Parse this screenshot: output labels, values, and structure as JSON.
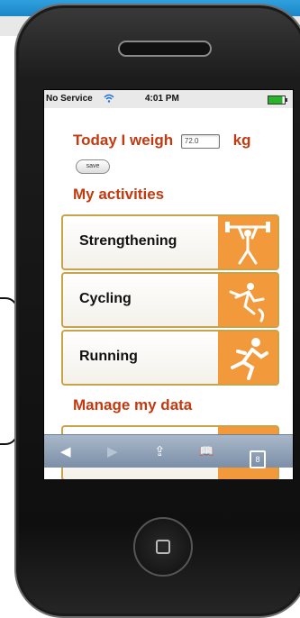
{
  "status": {
    "carrier": "No Service",
    "time": "4:01 PM"
  },
  "weigh": {
    "label_prefix": "Today I weigh",
    "value": "72.0",
    "unit": "kg",
    "save_label": "save"
  },
  "activities": {
    "title": "My activities",
    "items": [
      {
        "label": "Strengthening",
        "icon": "weightlifting-icon"
      },
      {
        "label": "Cycling",
        "icon": "cycling-icon"
      },
      {
        "label": "Running",
        "icon": "running-icon"
      }
    ]
  },
  "manage": {
    "title": "Manage my data"
  },
  "toolbar": {
    "back": "◀",
    "forward": "▶",
    "share": "⇪",
    "bookmarks": "📖",
    "tabs_count": "8"
  },
  "colors": {
    "accent": "#c33a10",
    "tile_orange": "#f29a3b",
    "border_gold": "#c9a34a"
  }
}
